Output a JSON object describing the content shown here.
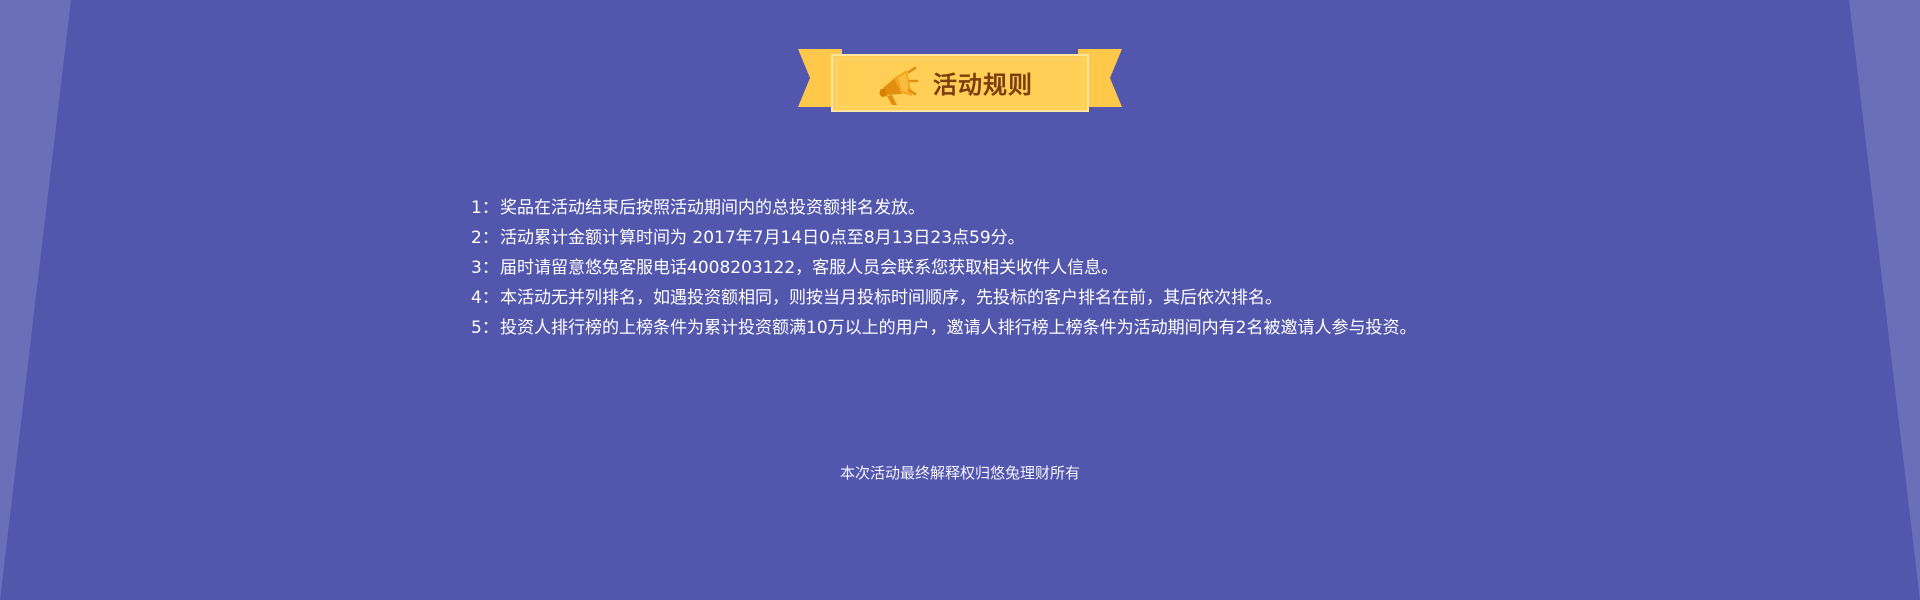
{
  "banner": {
    "title": "活动规则",
    "icon": "megaphone-icon"
  },
  "rules": [
    {
      "number": "1：",
      "text": "奖品在活动结束后按照活动期间内的总投资额排名发放。"
    },
    {
      "number": "2：",
      "text": "活动累计金额计算时间为 2017年7月14日0点至8月13日23点59分。"
    },
    {
      "number": "3：",
      "text": "届时请留意悠兔客服电话4008203122，客服人员会联系您获取相关收件人信息。"
    },
    {
      "number": "4：",
      "text": "本活动无并列排名，如遇投资额相同，则按当月投标时间顺序，先投标的客户排名在前，其后依次排名。"
    },
    {
      "number": "5：",
      "text": "投资人排行榜的上榜条件为累计投资额满10万以上的用户，邀请人排行榜上榜条件为活动期间内有2名被邀请人参与投资。"
    }
  ],
  "footer": {
    "text": "本次活动最终解释权归悠兔理财所有"
  },
  "colors": {
    "background": "#5256ad",
    "side_panel": "#6b6fba",
    "banner_yellow": "#ffcf55",
    "banner_text": "#7d3d0d",
    "icon_orange": "#e08f10",
    "body_text": "#ffffff"
  }
}
